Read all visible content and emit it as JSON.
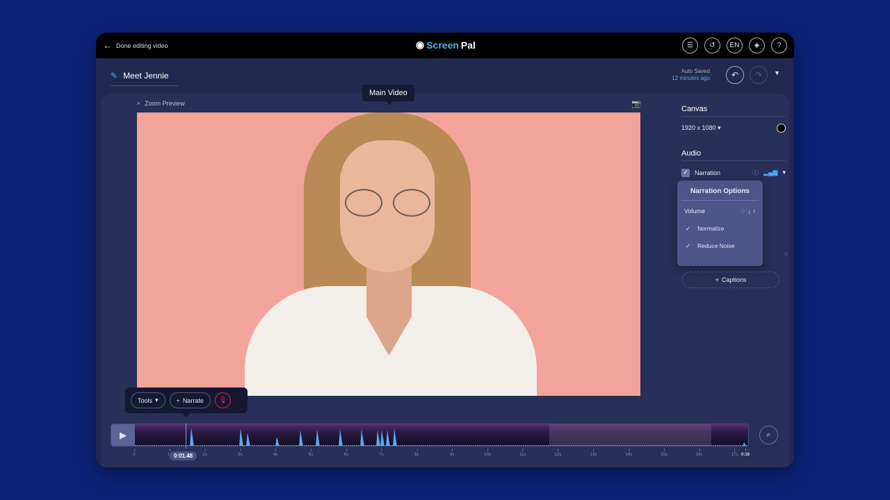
{
  "header": {
    "back_label": "Done editing video",
    "logo": {
      "prefix": "Screen",
      "suffix": "Pal"
    },
    "icons": [
      "checklist-icon",
      "history-icon",
      "language-icon",
      "layers-icon",
      "help-icon"
    ],
    "lang": "EN"
  },
  "project": {
    "title": "Meet Jennie",
    "autosave_label": "Auto Saved",
    "autosave_time": "12 minutes ago"
  },
  "preview": {
    "zoom_label": "Zoom Preview",
    "main_video_tooltip": "Main Video"
  },
  "side": {
    "canvas_heading": "Canvas",
    "canvas_size": "1920 x 1080",
    "canvas_color": "#000000",
    "audio_heading": "Audio",
    "narration_label": "Narration",
    "captions_label": "Captions"
  },
  "narration_options": {
    "title": "Narration Options",
    "volume_label": "Volume",
    "normalize": "Normalize",
    "reduce_noise": "Reduce Noise",
    "normalize_checked": true,
    "reduce_noise_checked": true
  },
  "toolbar": {
    "tools_label": "Tools",
    "narrate_label": "Narrate"
  },
  "timeline": {
    "playhead_time": "0:01.48",
    "end_label": "0:18",
    "ticks": [
      "0",
      "1s",
      "2s",
      "3s",
      "4s",
      "5s",
      "6s",
      "7s",
      "8s",
      "9s",
      "10s",
      "11s",
      "12s",
      "13s",
      "14s",
      "15s",
      "16s",
      "17s"
    ]
  },
  "colors": {
    "background": "#0b2277",
    "accent": "#5aa9f0",
    "record": "#e0245e"
  }
}
